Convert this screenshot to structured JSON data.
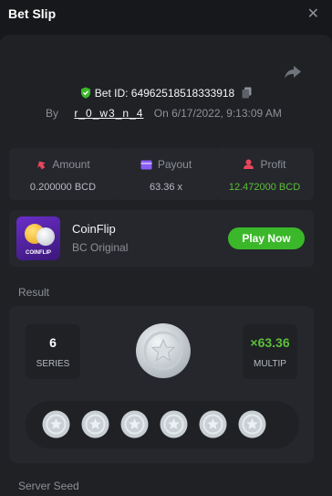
{
  "header": {
    "title": "Bet Slip",
    "close_glyph": "✕"
  },
  "bet": {
    "id_text": "Bet ID: 64962518518333918",
    "by_label": "By",
    "username": "r_0_w3_n_4",
    "on_label": "On",
    "datetime": "6/17/2022, 9:13:09 AM"
  },
  "stats": {
    "amount": {
      "label": "Amount",
      "value": "0.200000 BCD"
    },
    "payout": {
      "label": "Payout",
      "value": "63.36 x"
    },
    "profit": {
      "label": "Profit",
      "value": "12.472000 BCD"
    }
  },
  "game": {
    "name": "CoinFlip",
    "subtitle": "BC Original",
    "thumb_text": "COINFLIP",
    "play_label": "Play Now"
  },
  "result": {
    "label": "Result",
    "series_value": "6",
    "series_label": "SERIES",
    "multiplier_value": "×63.36",
    "multiplier_label": "MULTIP",
    "coin_count": 6
  },
  "server_seed_label": "Server Seed",
  "colors": {
    "background": "#17181b",
    "panel": "#1f2125",
    "card": "#25272c",
    "accent_green": "#3bb82a",
    "profit_green": "#5cbf3a",
    "amount_icon": "#e8465b",
    "payout_icon": "#8a5cf6",
    "profit_icon": "#e8465b"
  }
}
